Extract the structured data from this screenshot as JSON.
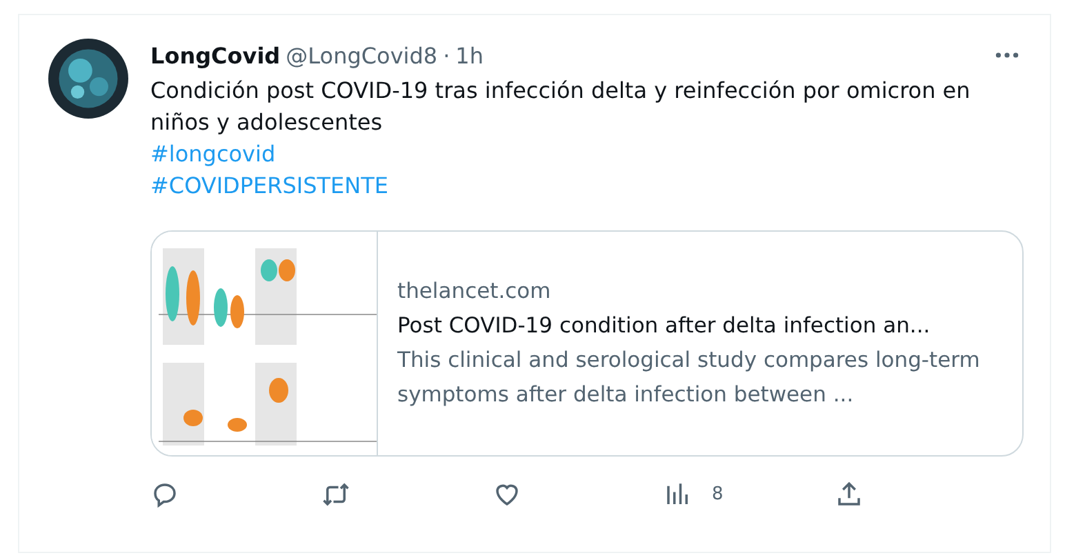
{
  "tweet": {
    "author_name": "LongCovid",
    "handle": "@LongCovid8",
    "separator": "·",
    "time": "1h",
    "text": "Condición post COVID-19 tras infección delta y reinfección por omicron en niños y adolescentes",
    "hashtags": [
      "#longcovid",
      "#COVIDPERSISTENTE"
    ],
    "card": {
      "domain": "thelancet.com",
      "title": "Post COVID-19 condition after delta infection an...",
      "description": "This clinical and serological study compares long-term symptoms after delta infection between ..."
    },
    "actions": [
      {
        "kind": "reply"
      },
      {
        "kind": "retweet"
      },
      {
        "kind": "like"
      },
      {
        "kind": "views",
        "count": "8"
      },
      {
        "kind": "share"
      }
    ]
  }
}
